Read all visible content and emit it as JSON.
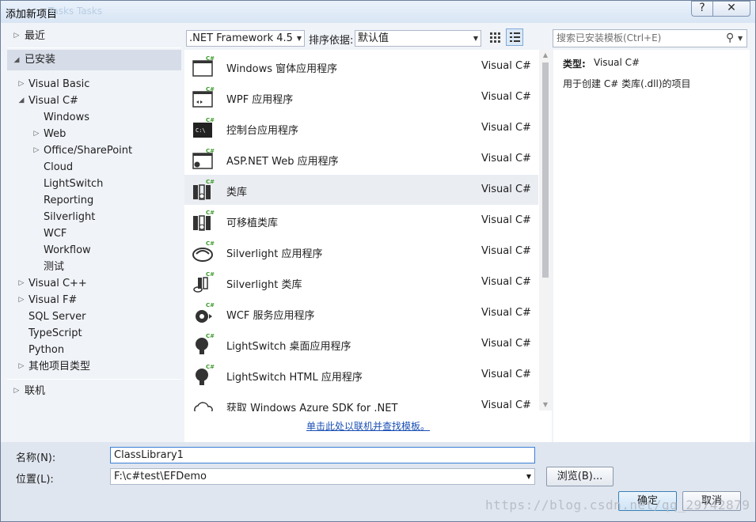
{
  "window": {
    "title": "添加新项目",
    "title_ghost": "Tasks Tasks",
    "help_label": "?",
    "close_label": "✕"
  },
  "tree": {
    "recent": "最近",
    "installed": "已安装",
    "visual_basic": "Visual Basic",
    "visual_csharp": "Visual C#",
    "children": [
      "Windows",
      "Web",
      "Office/SharePoint",
      "Cloud",
      "LightSwitch",
      "Reporting",
      "Silverlight",
      "WCF",
      "Workflow",
      "测试"
    ],
    "visual_cpp": "Visual C++",
    "visual_fsharp": "Visual F#",
    "sql_server": "SQL Server",
    "typescript": "TypeScript",
    "python": "Python",
    "other": "其他项目类型",
    "online": "联机"
  },
  "toolbar": {
    "framework": ".NET Framework 4.5",
    "sort_label": "排序依据:",
    "sort_value": "默认值"
  },
  "search": {
    "placeholder": "搜索已安装模板(Ctrl+E)"
  },
  "templates": [
    {
      "name": "Windows 窗体应用程序",
      "lang": "Visual C#"
    },
    {
      "name": "WPF 应用程序",
      "lang": "Visual C#"
    },
    {
      "name": "控制台应用程序",
      "lang": "Visual C#"
    },
    {
      "name": "ASP.NET Web 应用程序",
      "lang": "Visual C#"
    },
    {
      "name": "类库",
      "lang": "Visual C#"
    },
    {
      "name": "可移植类库",
      "lang": "Visual C#"
    },
    {
      "name": "Silverlight 应用程序",
      "lang": "Visual C#"
    },
    {
      "name": "Silverlight 类库",
      "lang": "Visual C#"
    },
    {
      "name": "WCF 服务应用程序",
      "lang": "Visual C#"
    },
    {
      "name": "LightSwitch 桌面应用程序",
      "lang": "Visual C#"
    },
    {
      "name": "LightSwitch HTML 应用程序",
      "lang": "Visual C#"
    },
    {
      "name": "获取 Windows Azure SDK for .NET",
      "lang": "Visual C#"
    }
  ],
  "online_link": "单击此处以联机并查找模板。",
  "details": {
    "type_label": "类型:",
    "type_value": "Visual C#",
    "description": "用于创建 C# 类库(.dll)的项目"
  },
  "form": {
    "name_label": "名称(N):",
    "name_value": "ClassLibrary1",
    "location_label": "位置(L):",
    "location_value": "F:\\c#test\\EFDemo",
    "browse": "浏览(B)...",
    "ok": "确定",
    "cancel": "取消"
  },
  "watermark": "https://blog.csdn.net/qq_29742879"
}
